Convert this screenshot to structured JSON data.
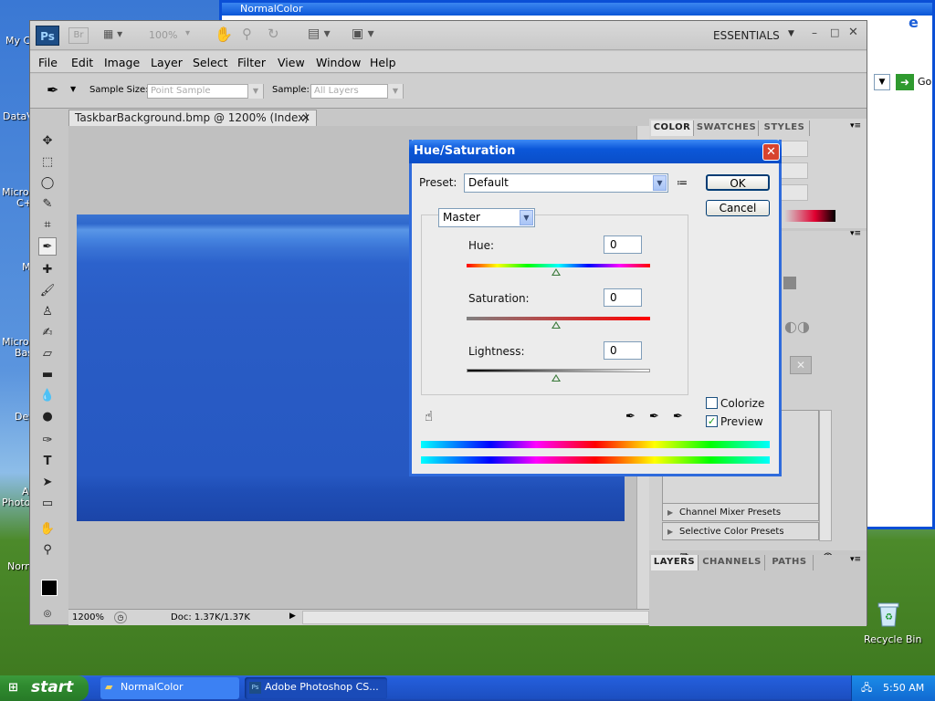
{
  "desktop": {
    "icons": [
      {
        "label": "My C"
      },
      {
        "label": "DataV"
      },
      {
        "label": "Micros"
      },
      {
        "label": "C+"
      },
      {
        "label": "M"
      },
      {
        "label": "Micros"
      },
      {
        "label": "Bas"
      },
      {
        "label": "Dev"
      },
      {
        "label": "A"
      },
      {
        "label": "Photo"
      },
      {
        "label": "Norm"
      },
      {
        "label": "Recycle Bin"
      }
    ]
  },
  "ie": {
    "title": "NormalColor",
    "go": "Go"
  },
  "ps": {
    "logo": "Ps",
    "br": "Br",
    "zoom": "100%",
    "workspace": "ESSENTIALS",
    "menu": [
      "File",
      "Edit",
      "Image",
      "Layer",
      "Select",
      "Filter",
      "View",
      "Window",
      "Help"
    ],
    "options": {
      "sample_size_label": "Sample Size:",
      "sample_size_value": "Point Sample",
      "sample_label": "Sample:",
      "sample_value": "All Layers"
    },
    "doc": {
      "tab": "TaskbarBackground.bmp @ 1200% (Index)"
    },
    "status": {
      "zoom": "1200%",
      "doc": "Doc: 1.37K/1.37K"
    },
    "panels": {
      "color_tabs": [
        "COLOR",
        "SWATCHES",
        "STYLES"
      ],
      "presets": [
        "Channel Mixer Presets",
        "Selective Color Presets"
      ],
      "layers_tabs": [
        "LAYERS",
        "CHANNELS",
        "PATHS"
      ]
    }
  },
  "dialog": {
    "title": "Hue/Saturation",
    "preset_label": "Preset:",
    "preset_value": "Default",
    "ok": "OK",
    "cancel": "Cancel",
    "channel": "Master",
    "hue_label": "Hue:",
    "hue_value": "0",
    "sat_label": "Saturation:",
    "sat_value": "0",
    "light_label": "Lightness:",
    "light_value": "0",
    "colorize": "Colorize",
    "colorize_checked": false,
    "preview": "Preview",
    "preview_checked": true
  },
  "taskbar": {
    "start": "start",
    "tasks": [
      "NormalColor",
      "Adobe Photoshop CS..."
    ],
    "clock": "5:50 AM"
  }
}
